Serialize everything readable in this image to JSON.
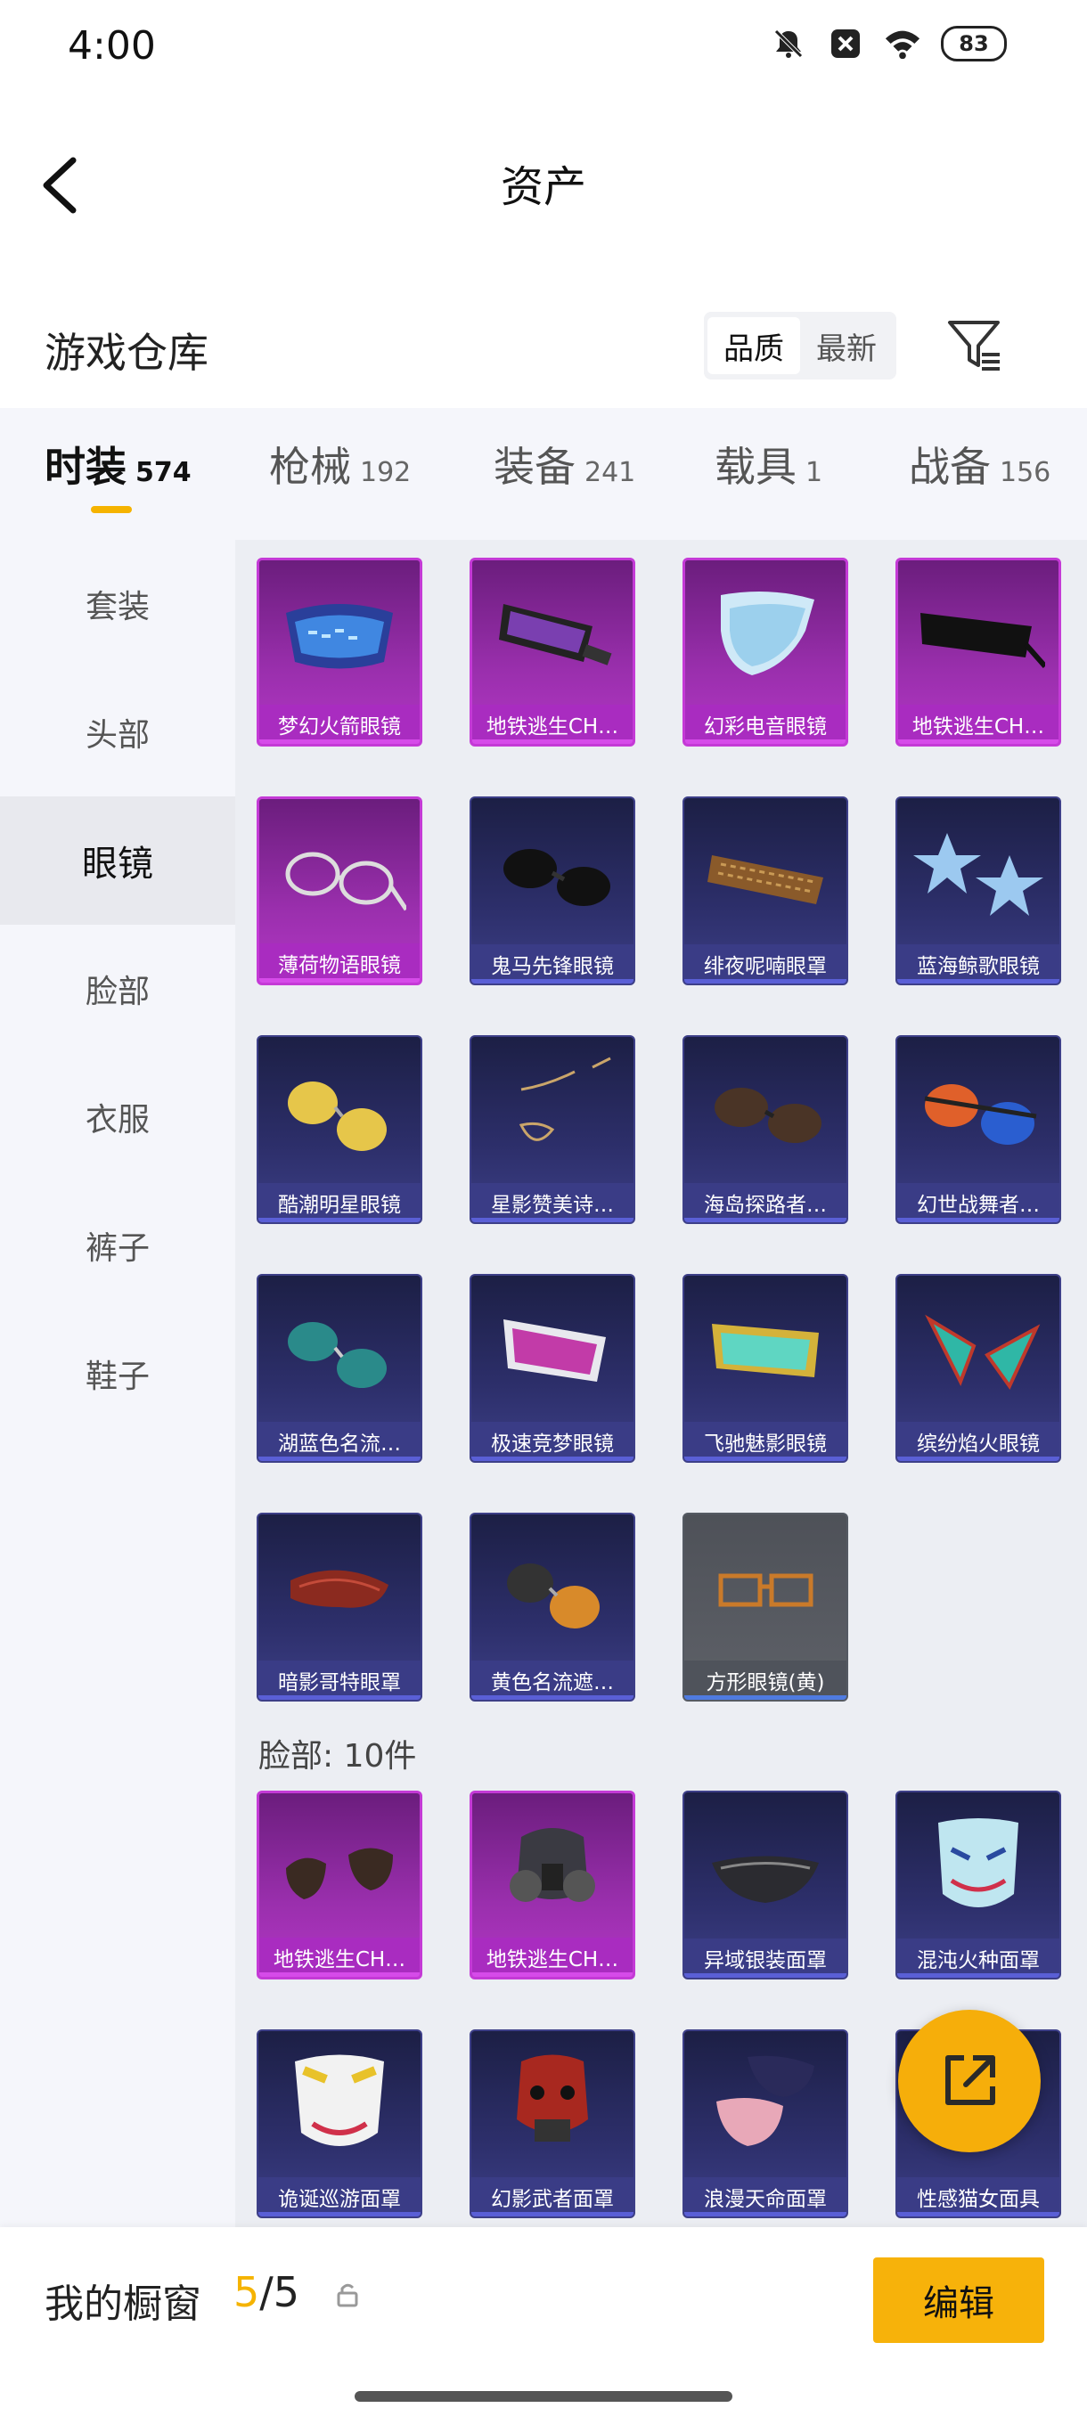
{
  "status": {
    "time": "4:00",
    "battery": "83"
  },
  "header": {
    "title": "资产"
  },
  "warehouse": {
    "title": "游戏仓库",
    "sort_options": [
      "品质",
      "最新"
    ]
  },
  "tabs": [
    {
      "label": "时装",
      "count": "574"
    },
    {
      "label": "枪械",
      "count": "192"
    },
    {
      "label": "装备",
      "count": "241"
    },
    {
      "label": "载具",
      "count": "1"
    },
    {
      "label": "战备",
      "count": "156"
    }
  ],
  "sidebar": [
    "套装",
    "头部",
    "眼镜",
    "脸部",
    "衣服",
    "裤子",
    "鞋子"
  ],
  "grid_items": [
    {
      "name": "梦幻火箭眼镜",
      "rarity": "purple"
    },
    {
      "name": "地铁逃生CH…",
      "rarity": "purple"
    },
    {
      "name": "幻彩电音眼镜",
      "rarity": "purple"
    },
    {
      "name": "地铁逃生CH…",
      "rarity": "purple"
    },
    {
      "name": "薄荷物语眼镜",
      "rarity": "purple"
    },
    {
      "name": "鬼马先锋眼镜",
      "rarity": "blue"
    },
    {
      "name": "绯夜呢喃眼罩",
      "rarity": "blue"
    },
    {
      "name": "蓝海鲸歌眼镜",
      "rarity": "blue"
    },
    {
      "name": "酷潮明星眼镜",
      "rarity": "blue"
    },
    {
      "name": "星影赞美诗…",
      "rarity": "blue"
    },
    {
      "name": "海岛探路者…",
      "rarity": "blue"
    },
    {
      "name": "幻世战舞者…",
      "rarity": "blue"
    },
    {
      "name": "湖蓝色名流…",
      "rarity": "blue"
    },
    {
      "name": "极速竞梦眼镜",
      "rarity": "blue"
    },
    {
      "name": "飞驰魅影眼镜",
      "rarity": "blue"
    },
    {
      "name": "缤纷焰火眼镜",
      "rarity": "blue"
    },
    {
      "name": "暗影哥特眼罩",
      "rarity": "blue"
    },
    {
      "name": "黄色名流遮…",
      "rarity": "blue"
    },
    {
      "name": "方形眼镜(黄)",
      "rarity": "gray"
    }
  ],
  "section_label": "脸部: 10件",
  "face_items": [
    {
      "name": "地铁逃生CH…",
      "rarity": "purple"
    },
    {
      "name": "地铁逃生CH…",
      "rarity": "purple"
    },
    {
      "name": "异域银装面罩",
      "rarity": "blue"
    },
    {
      "name": "混沌火种面罩",
      "rarity": "blue"
    },
    {
      "name": "诡诞巡游面罩",
      "rarity": "blue"
    },
    {
      "name": "幻影武者面罩",
      "rarity": "blue"
    },
    {
      "name": "浪漫天命面罩",
      "rarity": "blue"
    },
    {
      "name": "性感猫女面具",
      "rarity": "blue"
    }
  ],
  "showcase": {
    "label": "我的橱窗",
    "current": "5",
    "total": "/5",
    "edit_label": "编辑"
  },
  "colors": {
    "accent": "#f5b300",
    "purple": "#a92cc0",
    "blue": "#3a3c86"
  }
}
